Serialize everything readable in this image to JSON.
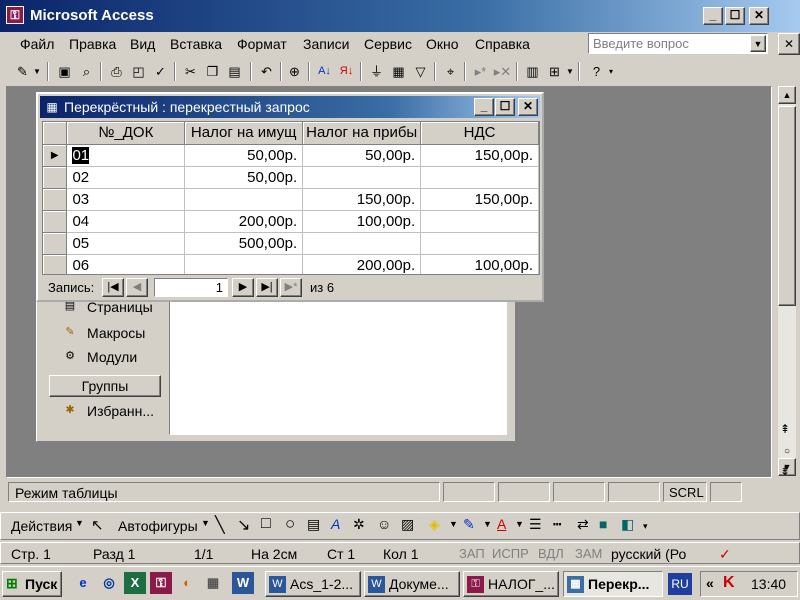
{
  "app": {
    "title": "Microsoft Access",
    "icon": "access-icon"
  },
  "menu": {
    "items": [
      "Файл",
      "Правка",
      "Вид",
      "Вставка",
      "Формат",
      "Записи",
      "Сервис",
      "Окно",
      "Справка"
    ],
    "ask_placeholder": "Введите вопрос"
  },
  "toolbar": {
    "icons": [
      "view-icon",
      "save-icon",
      "search-icon",
      "print-icon",
      "print-preview-icon",
      "spelling-icon",
      "cut-icon",
      "copy-icon",
      "paste-icon",
      "undo-icon",
      "hyperlink-icon",
      "sort-ascending-icon",
      "sort-descending-icon",
      "filter-by-selection-icon",
      "filter-by-form-icon",
      "apply-filter-icon",
      "find-icon",
      "new-record-icon",
      "delete-record-icon",
      "database-window-icon",
      "new-object-icon",
      "help-icon"
    ]
  },
  "query_window": {
    "title": "Перекрёстный : перекрестный запрос",
    "columns": [
      "№_ДОК",
      "Налог на имущ",
      "Налог на прибы",
      "НДС"
    ],
    "rows": [
      [
        "01",
        "50,00р.",
        "50,00р.",
        "150,00р."
      ],
      [
        "02",
        "50,00р.",
        "",
        ""
      ],
      [
        "03",
        "",
        "150,00р.",
        "150,00р."
      ],
      [
        "04",
        "200,00р.",
        "100,00р.",
        ""
      ],
      [
        "05",
        "500,00р.",
        "",
        ""
      ],
      [
        "06",
        "",
        "200,00р.",
        "100,00р."
      ]
    ],
    "nav": {
      "label": "Запись:",
      "current": "1",
      "total_label": "из 6"
    }
  },
  "db_window": {
    "items": [
      {
        "label": "Страницы",
        "icon": "page-icon"
      },
      {
        "label": "Макросы",
        "icon": "macro-icon"
      },
      {
        "label": "Модули",
        "icon": "module-icon"
      }
    ],
    "groups_label": "Группы",
    "favorites_label": "Избранн..."
  },
  "status": {
    "text": "Режим таблицы",
    "scrl": "SCRL"
  },
  "drawing": {
    "actions": "Действия",
    "autoshapes": "Автофигуры"
  },
  "word_status": {
    "page": "Стр. 1",
    "section": "Разд 1",
    "pages": "1/1",
    "at": "На 2см",
    "line": "Ст 1",
    "col": "Кол 1",
    "rec": "ЗАП",
    "trk": "ИСПР",
    "ext": "ВДЛ",
    "ovr": "ЗАМ",
    "lang": "русский (Ро"
  },
  "taskbar": {
    "start": "Пуск",
    "tasks": [
      "Acs_1-2...",
      "Докуме...",
      "НАЛОГ_...",
      "Перекр..."
    ],
    "lang": "RU",
    "time": "13:40"
  }
}
